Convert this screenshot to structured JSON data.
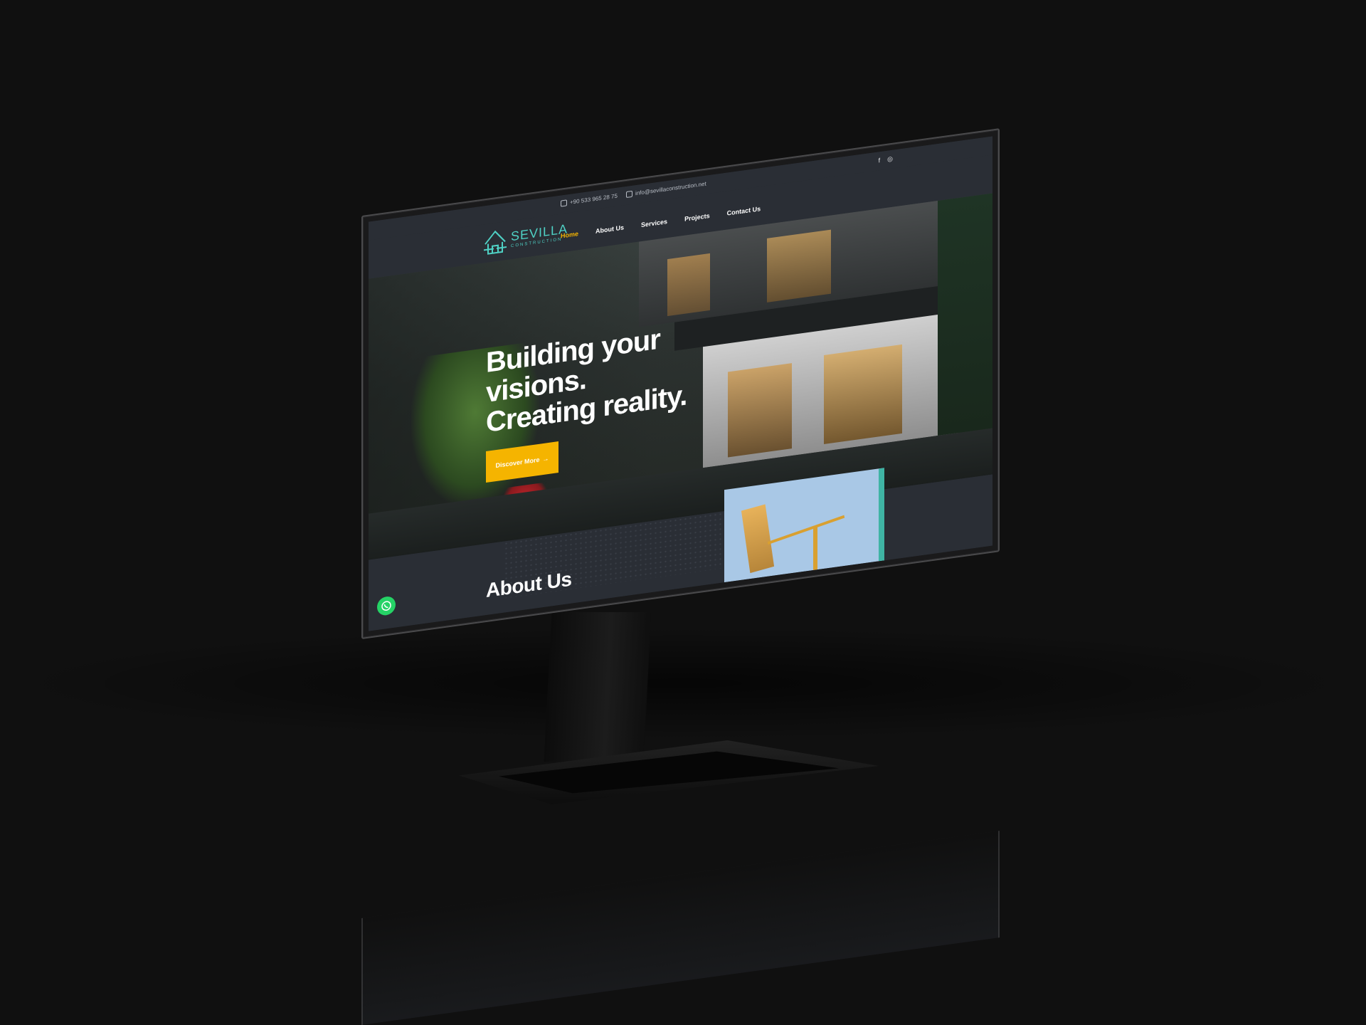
{
  "topbar": {
    "phone": "+90 533 965 28 75",
    "email": "info@sevillaconstruction.net",
    "social": [
      "facebook-icon",
      "instagram-icon"
    ]
  },
  "brand": {
    "name": "SEVILLA",
    "tagline": "CONSTRUCTION",
    "accent": "#4fd1c5"
  },
  "nav": {
    "items": [
      {
        "label": "Home",
        "active": true
      },
      {
        "label": "About Us",
        "active": false
      },
      {
        "label": "Services",
        "active": false
      },
      {
        "label": "Projects",
        "active": false
      },
      {
        "label": "Contact Us",
        "active": false
      }
    ]
  },
  "hero": {
    "title_lines": [
      "Building your",
      "visions.",
      "Creating reality."
    ],
    "cta_label": "Discover More",
    "cta_color": "#f5b400"
  },
  "about": {
    "title": "About Us"
  },
  "floating": {
    "whatsapp_icon": "whatsapp-icon",
    "whatsapp_color": "#25d366"
  }
}
